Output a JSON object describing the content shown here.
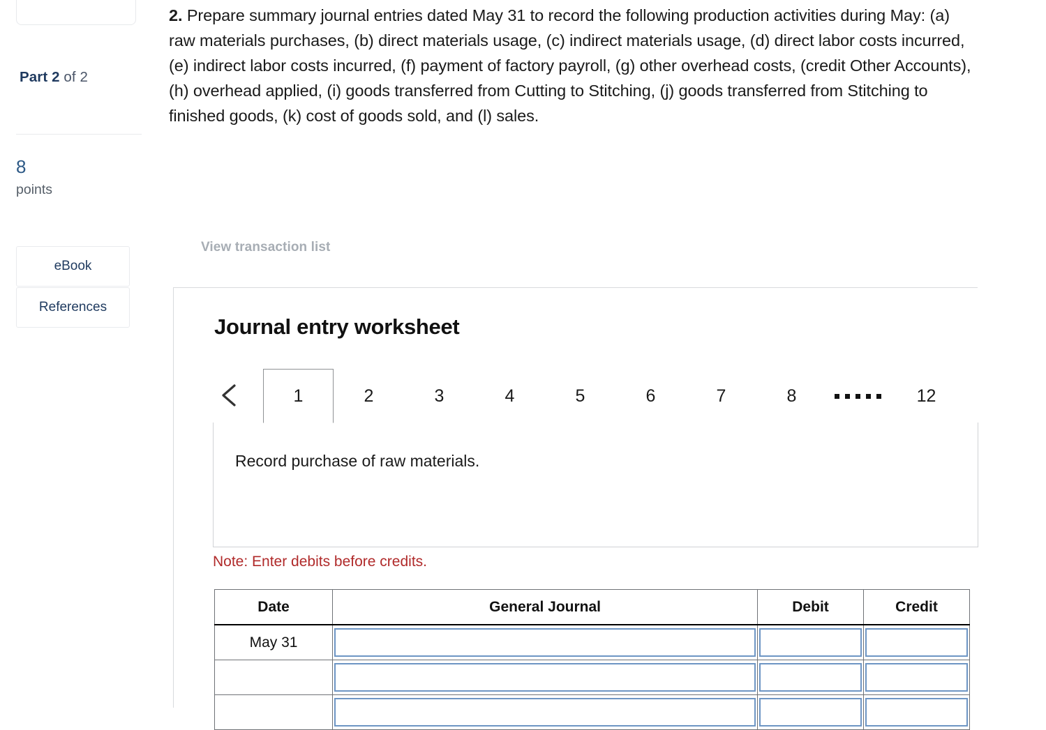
{
  "sidebar": {
    "part_label_prefix": "Part 2",
    "part_label_suffix": " of 2",
    "points_value": "8",
    "points_label": "points",
    "ebook_label": "eBook",
    "references_label": "References"
  },
  "question": {
    "number": "2.",
    "text": " Prepare summary journal entries dated May 31 to record the following production activities during May: (a) raw materials purchases, (b) direct materials usage, (c) indirect materials usage, (d) direct labor costs incurred, (e) indirect labor costs incurred, (f) payment of factory payroll, (g) other overhead costs, (credit Other Accounts), (h) overhead applied, (i) goods transferred from Cutting to Stitching, (j) goods transferred from Stitching to finished goods, (k) cost of goods sold, and (l) sales."
  },
  "worksheet": {
    "view_transaction_list_label": "View transaction list",
    "title": "Journal entry worksheet",
    "prev_arrow_icon": "chevron-left-icon",
    "tabs": [
      "1",
      "2",
      "3",
      "4",
      "5",
      "6",
      "7",
      "8"
    ],
    "tabs_ellipsis": ".....",
    "tab_last": "12",
    "active_tab": "1",
    "description": "Record purchase of raw materials.",
    "note": "Note: Enter debits before credits.",
    "note_color": "#b02a2a",
    "input_border_color": "#6d95c4"
  },
  "journal_table": {
    "headers": [
      "Date",
      "General Journal",
      "Debit",
      "Credit"
    ],
    "rows": [
      {
        "date": "May 31",
        "general_journal": "",
        "debit": "",
        "credit": ""
      },
      {
        "date": "",
        "general_journal": "",
        "debit": "",
        "credit": ""
      },
      {
        "date": "",
        "general_journal": "",
        "debit": "",
        "credit": ""
      }
    ]
  }
}
